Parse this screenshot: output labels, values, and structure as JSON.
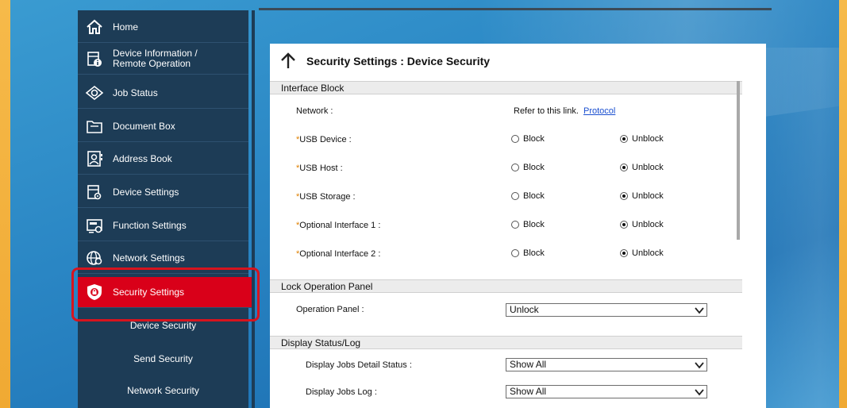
{
  "colors": {
    "sidebar_bg": "#1d3c56",
    "active_bg": "#d90019",
    "highlight_ring": "#d7141e",
    "link": "#1a4fd0",
    "required_mark": "#e08000"
  },
  "sidebar": {
    "items": [
      {
        "label": "Home",
        "icon": "home-icon"
      },
      {
        "label": "Device Information /",
        "label2": "Remote Operation",
        "icon": "device-info-icon"
      },
      {
        "label": "Job Status",
        "icon": "eye-icon"
      },
      {
        "label": "Document Box",
        "icon": "document-box-icon"
      },
      {
        "label": "Address Book",
        "icon": "address-book-icon"
      },
      {
        "label": "Device Settings",
        "icon": "device-settings-icon"
      },
      {
        "label": "Function Settings",
        "icon": "function-settings-icon"
      },
      {
        "label": "Network Settings",
        "icon": "globe-gear-icon"
      },
      {
        "label": "Security Settings",
        "icon": "shield-lock-icon",
        "active": true
      }
    ],
    "sub_items": [
      "Device Security",
      "Send Security",
      "Network Security"
    ]
  },
  "panel": {
    "title": "Security Settings : Device Security",
    "interface_block": {
      "heading": "Interface Block",
      "network": {
        "label": "Network :",
        "text": "Refer to this link.",
        "link": "Protocol"
      },
      "rows": [
        {
          "label": "USB Device :",
          "block": "Block",
          "unblock": "Unblock",
          "selected": "Unblock"
        },
        {
          "label": "USB Host :",
          "block": "Block",
          "unblock": "Unblock",
          "selected": "Unblock"
        },
        {
          "label": "USB Storage :",
          "block": "Block",
          "unblock": "Unblock",
          "selected": "Unblock"
        },
        {
          "label": "Optional Interface 1 :",
          "block": "Block",
          "unblock": "Unblock",
          "selected": "Unblock"
        },
        {
          "label": "Optional Interface 2 :",
          "block": "Block",
          "unblock": "Unblock",
          "selected": "Unblock"
        }
      ]
    },
    "lock_operation_panel": {
      "heading": "Lock Operation Panel",
      "label": "Operation Panel :",
      "value": "Unlock"
    },
    "display_status": {
      "heading": "Display Status/Log",
      "detail_label": "Display Jobs Detail Status :",
      "detail_value": "Show All",
      "log_label": "Display Jobs Log :",
      "log_value": "Show All"
    }
  },
  "required_mark": "*"
}
